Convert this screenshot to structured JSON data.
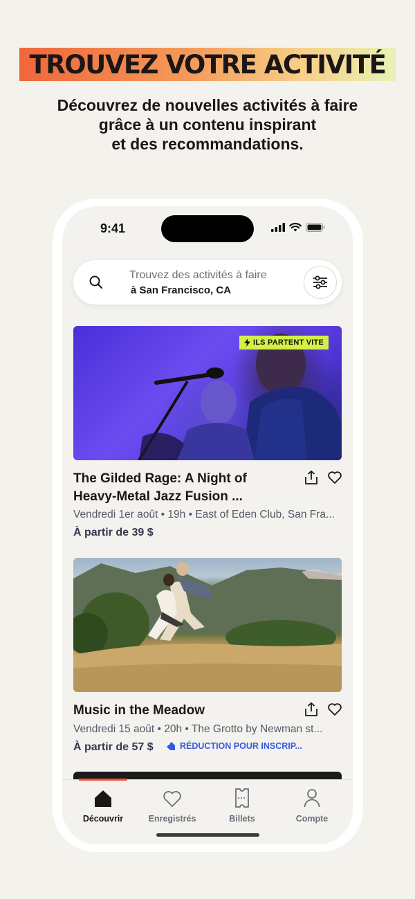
{
  "promo": {
    "headline": "TROUVEZ VOTRE ACTIVITÉ",
    "subtitle_lines": [
      "Découvrez de nouvelles activités à faire",
      "grâce à un contenu inspirant",
      "et des recommandations."
    ]
  },
  "status_bar": {
    "time": "9:41",
    "icons": [
      "signal-icon",
      "wifi-icon",
      "battery-icon"
    ]
  },
  "search": {
    "placeholder": "Trouvez des activités à faire",
    "location": "à San Francisco, CA",
    "icon": "search-icon",
    "filter_icon": "filter-sliders-icon"
  },
  "events": [
    {
      "badge": "ILS PARTENT VITE",
      "badge_icon": "lightning-icon",
      "title_line1": "The Gilded Rage: A Night of",
      "title_line2": "Heavy-Metal Jazz Fusion ...",
      "meta": "Vendredi 1er août • 19h • East of Eden Club, San Fra...",
      "price": "À partir de 39 $",
      "image": "concert-photo"
    },
    {
      "title_line1": "Music in the Meadow",
      "meta": "Vendredi 15 août • 20h • The Grotto by Newman st...",
      "price": "À partir de 57 $",
      "discount": "RÉDUCTION POUR INSCRIP...",
      "discount_icon": "tag-icon",
      "image": "meadow-photo"
    }
  ],
  "tabs": [
    {
      "label": "Découvrir",
      "icon": "home-icon",
      "active": true
    },
    {
      "label": "Enregistrés",
      "icon": "heart-icon",
      "active": false
    },
    {
      "label": "Billets",
      "icon": "ticket-icon",
      "active": false
    },
    {
      "label": "Compte",
      "icon": "person-icon",
      "active": false
    }
  ],
  "colors": {
    "accent_orange": "#f05537",
    "badge_lime": "#d4f046",
    "discount_blue": "#3659e3",
    "background": "#f3f2ed"
  }
}
